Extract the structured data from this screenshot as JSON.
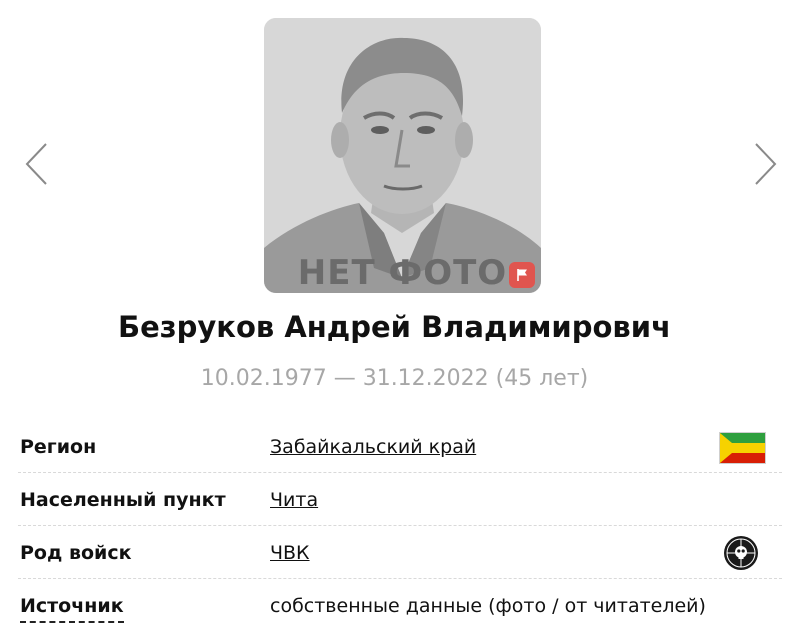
{
  "photo": {
    "placeholder_text": "НЕТ ФОТО",
    "report_icon": "flag-icon"
  },
  "navigation": {
    "prev_icon": "chevron-left-icon",
    "next_icon": "chevron-right-icon"
  },
  "person": {
    "name": "Безруков Андрей Владимирович",
    "dates": "10.02.1977 — 31.12.2022 (45 лет)"
  },
  "info": {
    "rows": [
      {
        "label": "Регион",
        "value": "Забайкальский край",
        "icon": "zabaykalsky-flag-icon"
      },
      {
        "label": "Населенный пункт",
        "value": "Чита"
      },
      {
        "label": "Род войск",
        "value": "ЧВК",
        "icon": "pmc-emblem-icon"
      },
      {
        "label": "Источник",
        "value": "собственные данные (фото / от читателей)"
      }
    ]
  },
  "colors": {
    "accent_flag": "#e0554f",
    "dates_gray": "#a7a7a7",
    "flag_green": "#2e9f3e",
    "flag_yellow": "#f6d200",
    "flag_red": "#d81e05"
  }
}
